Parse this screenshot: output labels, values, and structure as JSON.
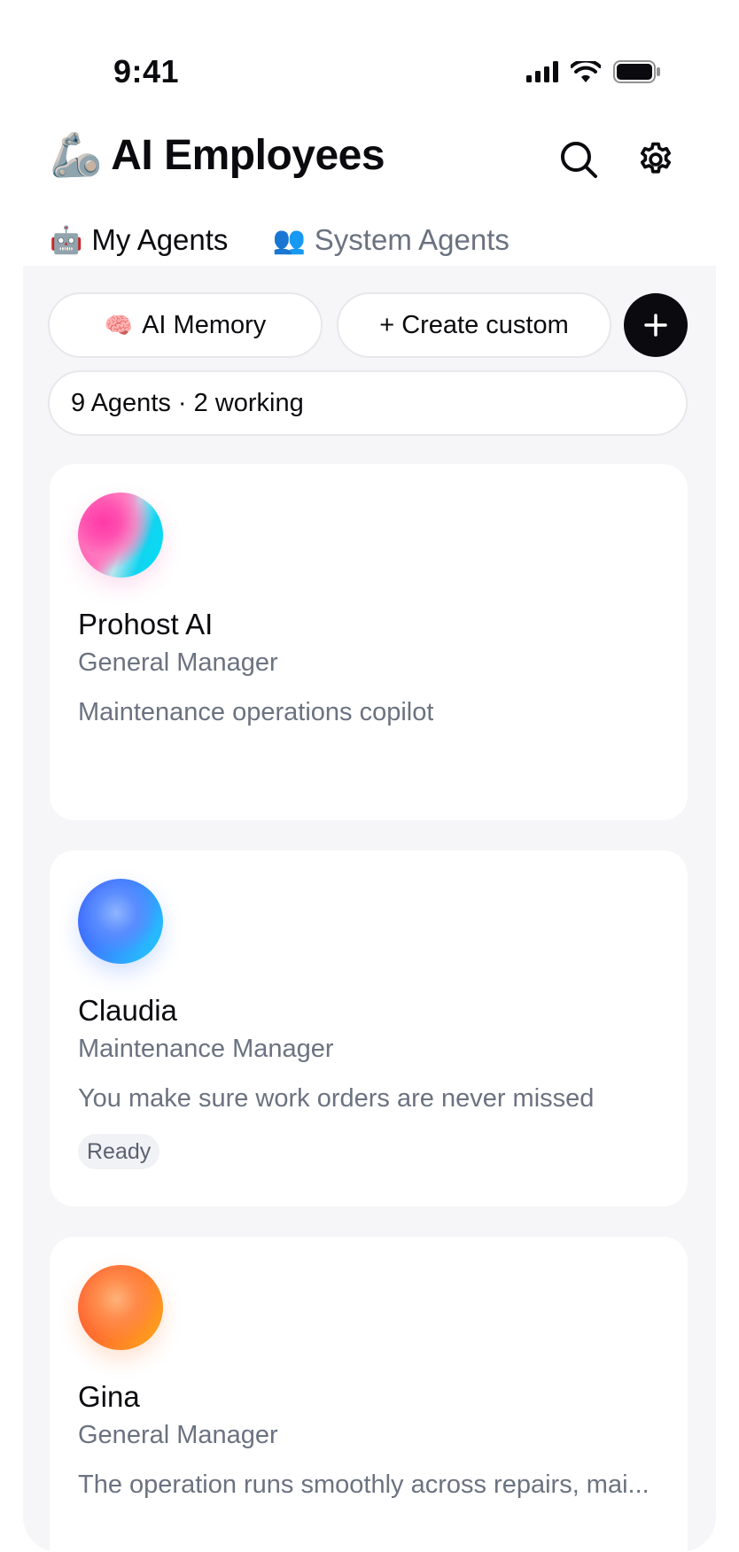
{
  "status_bar": {
    "time": "9:41"
  },
  "header": {
    "emoji": "🦾",
    "title": "AI Employees"
  },
  "tabs": [
    {
      "emoji": "🤖",
      "label": "My Agents",
      "active": true
    },
    {
      "emoji": "👥",
      "label": "System Agents",
      "active": false
    }
  ],
  "actions": {
    "memory": {
      "emoji": "🧠",
      "label": "AI Memory"
    },
    "create": {
      "label": "+ Create custom"
    }
  },
  "summary": "9 Agents · 2 working",
  "agents": [
    {
      "name": "Prohost AI",
      "role": "General Manager",
      "description": "Maintenance operations copilot",
      "status": ""
    },
    {
      "name": "Claudia",
      "role": "Maintenance Manager",
      "description": "You make sure work orders are never missed",
      "status": "Ready"
    },
    {
      "name": "Gina",
      "role": "General Manager",
      "description": "The operation runs smoothly across repairs, mai...",
      "status": ""
    }
  ],
  "colors": {
    "accent": "#0b0b0f",
    "muted_text": "#6b7280",
    "panel_bg": "#f6f6f8"
  },
  "icons": [
    "cellular-signal-icon",
    "wifi-icon",
    "battery-icon",
    "search-icon",
    "gear-icon",
    "plus-icon"
  ]
}
